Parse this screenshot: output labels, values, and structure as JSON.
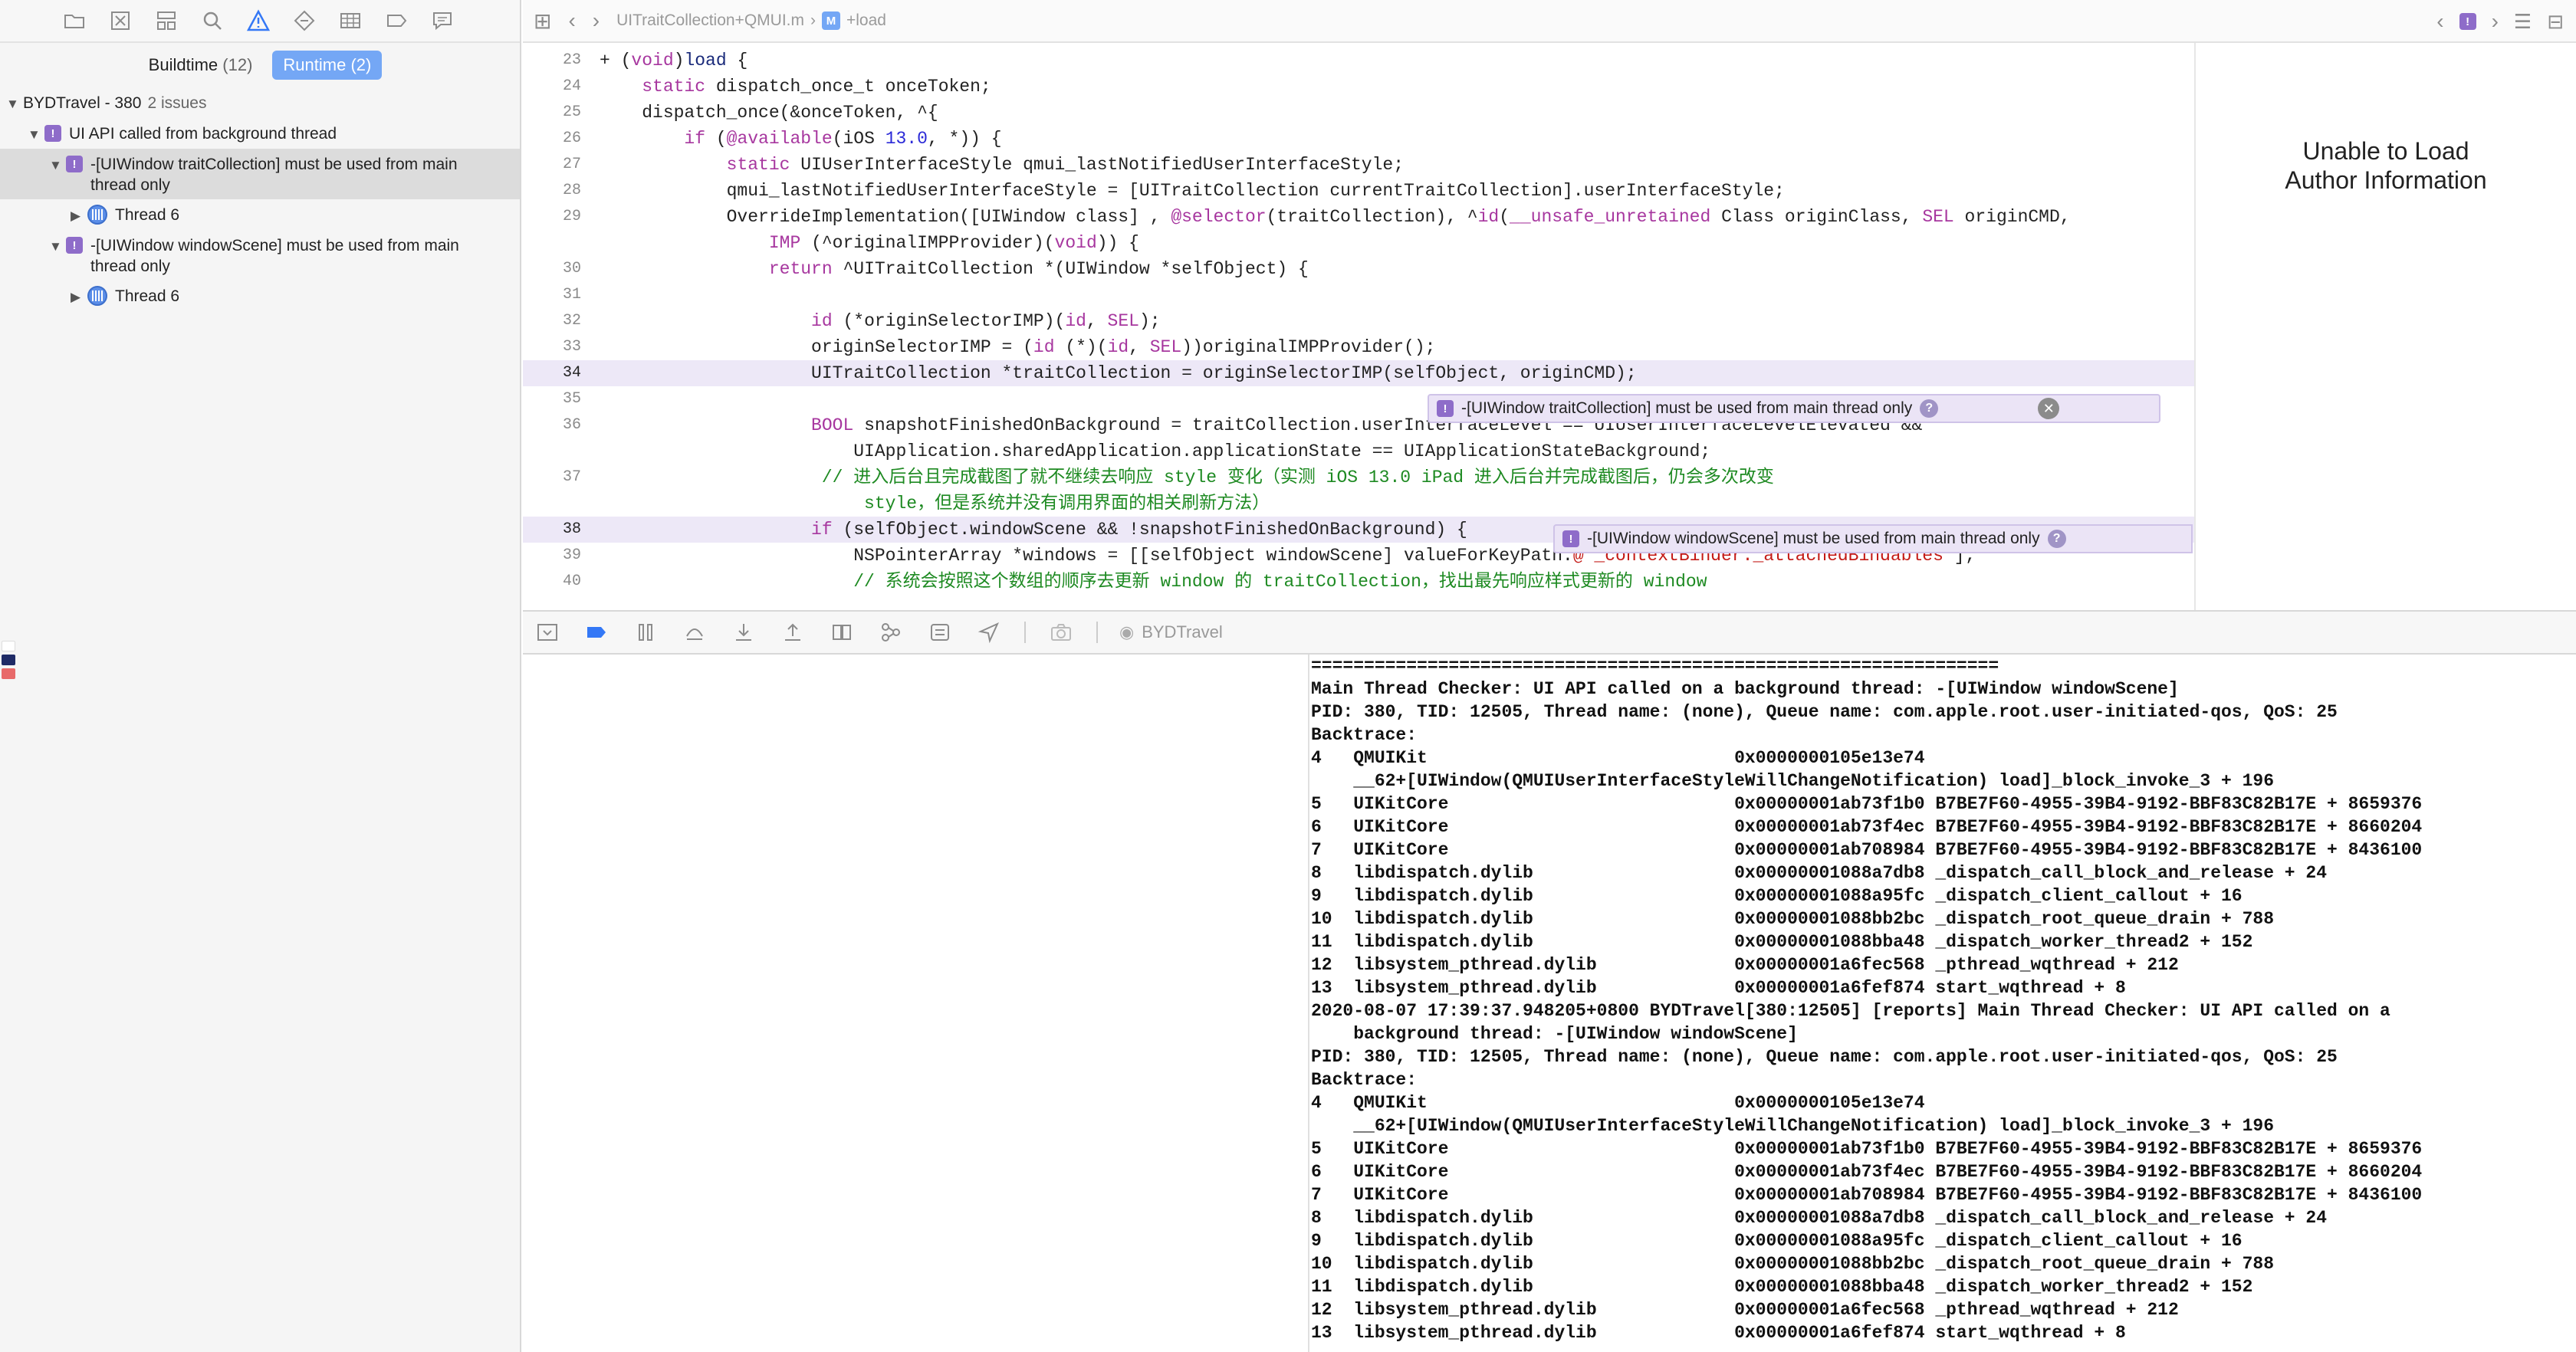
{
  "navigator": {
    "toolbar_icons": [
      "folder-icon",
      "source-control-icon",
      "symbol-icon",
      "find-icon",
      "issue-warning-icon",
      "test-icon",
      "debug-icon",
      "breakpoint-icon",
      "report-icon"
    ],
    "filter": {
      "buildtime_label": "Buildtime",
      "buildtime_count": "(12)",
      "runtime_label": "Runtime",
      "runtime_count": "(2)"
    },
    "tree": {
      "project": "BYDTravel - 380",
      "project_issues": "2 issues",
      "group": "UI API called from background thread",
      "issue1": "-[UIWindow traitCollection] must be used from main thread only",
      "issue1_thread": "Thread 6",
      "issue2": "-[UIWindow windowScene] must be used from main thread only",
      "issue2_thread": "Thread 6"
    }
  },
  "jump_bar": {
    "file": "UITraitCollection+QMUI.m",
    "method_badge": "M",
    "method": "+load"
  },
  "code": [
    {
      "n": "23",
      "html": "+ (<span class='kw'>void</span>)<span class='typ'>load</span> {"
    },
    {
      "n": "24",
      "html": "    <span class='kw'>static</span> dispatch_once_t onceToken;"
    },
    {
      "n": "25",
      "html": "    dispatch_once(&amp;onceToken, ^{"
    },
    {
      "n": "26",
      "html": "        <span class='kw'>if</span> (<span class='kw'>@available</span>(iOS <span class='num'>13.0</span>, *)) {"
    },
    {
      "n": "27",
      "html": "            <span class='kw'>static</span> UIUserInterfaceStyle qmui_lastNotifiedUserInterfaceStyle;"
    },
    {
      "n": "28",
      "html": "            qmui_lastNotifiedUserInterfaceStyle = [UITraitCollection currentTraitCollection].userInterfaceStyle;"
    },
    {
      "n": "29",
      "wrap": true,
      "html": "            OverrideImplementation([UIWindow class] , <span class='kw'>@selector</span>(traitCollection), ^<span class='kw'>id</span>(<span class='kw'>__unsafe_unretained</span> Class originClass, <span class='kw'>SEL</span> originCMD,\n                <span class='kw'>IMP</span> (^originalIMPProvider)(<span class='kw'>void</span>)) {"
    },
    {
      "n": "30",
      "html": "                <span class='kw'>return</span> ^UITraitCollection *(UIWindow *selfObject) {"
    },
    {
      "n": "31",
      "html": ""
    },
    {
      "n": "32",
      "html": "                    <span class='kw'>id</span> (*originSelectorIMP)(<span class='kw'>id</span>, <span class='kw'>SEL</span>);"
    },
    {
      "n": "33",
      "html": "                    originSelectorIMP = (<span class='kw'>id</span> (*)(<span class='kw'>id</span>, <span class='kw'>SEL</span>))originalIMPProvider();"
    },
    {
      "n": "34",
      "hl": true,
      "html": "                    UITraitCollection *traitCollection = originSelectorIMP(selfObject, originCMD);"
    },
    {
      "n": "35",
      "html": ""
    },
    {
      "n": "36",
      "wrap": true,
      "html": "                    <span class='kw'>BOOL</span> snapshotFinishedOnBackground = traitCollection.userInterfaceLevel == UIUserInterfaceLevelElevated &amp;&amp;\n                        UIApplication.sharedApplication.applicationState == UIApplicationStateBackground;"
    },
    {
      "n": "37",
      "wrap": true,
      "html": "<span class='cmt'>                     // 进入后台且完成截图了就不继续去响应 style 变化（实测 iOS 13.0 iPad 进入后台并完成截图后，仍会多次改变\n                         style，但是系统并没有调用界面的相关刷新方法）</span>"
    },
    {
      "n": "38",
      "hl": true,
      "html": "                    <span class='kw'>if</span> (selfObject.windowScene &amp;&amp; !snapshotFinishedOnBackground) {"
    },
    {
      "n": "39",
      "html": "                        NSPointerArray *windows = [[selfObject windowScene] valueForKeyPath:<span class='str'>@\"_contextBinder._attachedBindables\"</span>];"
    },
    {
      "n": "40",
      "html": "<span class='cmt'>                        // 系统会按照这个数组的顺序去更新 window 的 traitCollection，找出最先响应样式更新的 window</span>"
    }
  ],
  "banners": {
    "trait": "-[UIWindow traitCollection] must be used from main thread only",
    "scene": "-[UIWindow windowScene] must be used from main thread only"
  },
  "author_panel": {
    "line1": "Unable to Load",
    "line2": "Author Information"
  },
  "debug_bar": {
    "target": "BYDTravel"
  },
  "console": {
    "text": "=================================================================\nMain Thread Checker: UI API called on a background thread: -[UIWindow windowScene]\nPID: 380, TID: 12505, Thread name: (none), Queue name: com.apple.root.user-initiated-qos, QoS: 25\nBacktrace:\n4   QMUIKit                             0x0000000105e13e74\n    __62+[UIWindow(QMUIUserInterfaceStyleWillChangeNotification) load]_block_invoke_3 + 196\n5   UIKitCore                           0x00000001ab73f1b0 B7BE7F60-4955-39B4-9192-BBF83C82B17E + 8659376\n6   UIKitCore                           0x00000001ab73f4ec B7BE7F60-4955-39B4-9192-BBF83C82B17E + 8660204\n7   UIKitCore                           0x00000001ab708984 B7BE7F60-4955-39B4-9192-BBF83C82B17E + 8436100\n8   libdispatch.dylib                   0x00000001088a7db8 _dispatch_call_block_and_release + 24\n9   libdispatch.dylib                   0x00000001088a95fc _dispatch_client_callout + 16\n10  libdispatch.dylib                   0x00000001088bb2bc _dispatch_root_queue_drain + 788\n11  libdispatch.dylib                   0x00000001088bba48 _dispatch_worker_thread2 + 152\n12  libsystem_pthread.dylib             0x00000001a6fec568 _pthread_wqthread + 212\n13  libsystem_pthread.dylib             0x00000001a6fef874 start_wqthread + 8\n2020-08-07 17:39:37.948205+0800 BYDTravel[380:12505] [reports] Main Thread Checker: UI API called on a\n    background thread: -[UIWindow windowScene]\nPID: 380, TID: 12505, Thread name: (none), Queue name: com.apple.root.user-initiated-qos, QoS: 25\nBacktrace:\n4   QMUIKit                             0x0000000105e13e74\n    __62+[UIWindow(QMUIUserInterfaceStyleWillChangeNotification) load]_block_invoke_3 + 196\n5   UIKitCore                           0x00000001ab73f1b0 B7BE7F60-4955-39B4-9192-BBF83C82B17E + 8659376\n6   UIKitCore                           0x00000001ab73f4ec B7BE7F60-4955-39B4-9192-BBF83C82B17E + 8660204\n7   UIKitCore                           0x00000001ab708984 B7BE7F60-4955-39B4-9192-BBF83C82B17E + 8436100\n8   libdispatch.dylib                   0x00000001088a7db8 _dispatch_call_block_and_release + 24\n9   libdispatch.dylib                   0x00000001088a95fc _dispatch_client_callout + 16\n10  libdispatch.dylib                   0x00000001088bb2bc _dispatch_root_queue_drain + 788\n11  libdispatch.dylib                   0x00000001088bba48 _dispatch_worker_thread2 + 152\n12  libsystem_pthread.dylib             0x00000001a6fec568 _pthread_wqthread + 212\n13  libsystem_pthread.dylib             0x00000001a6fef874 start_wqthread + 8"
  },
  "colors": {
    "accent": "#3478f6",
    "runtime_issue": "#8e6cc9",
    "selection": "#74a7f5",
    "highlight_line": "#ede8f7"
  }
}
